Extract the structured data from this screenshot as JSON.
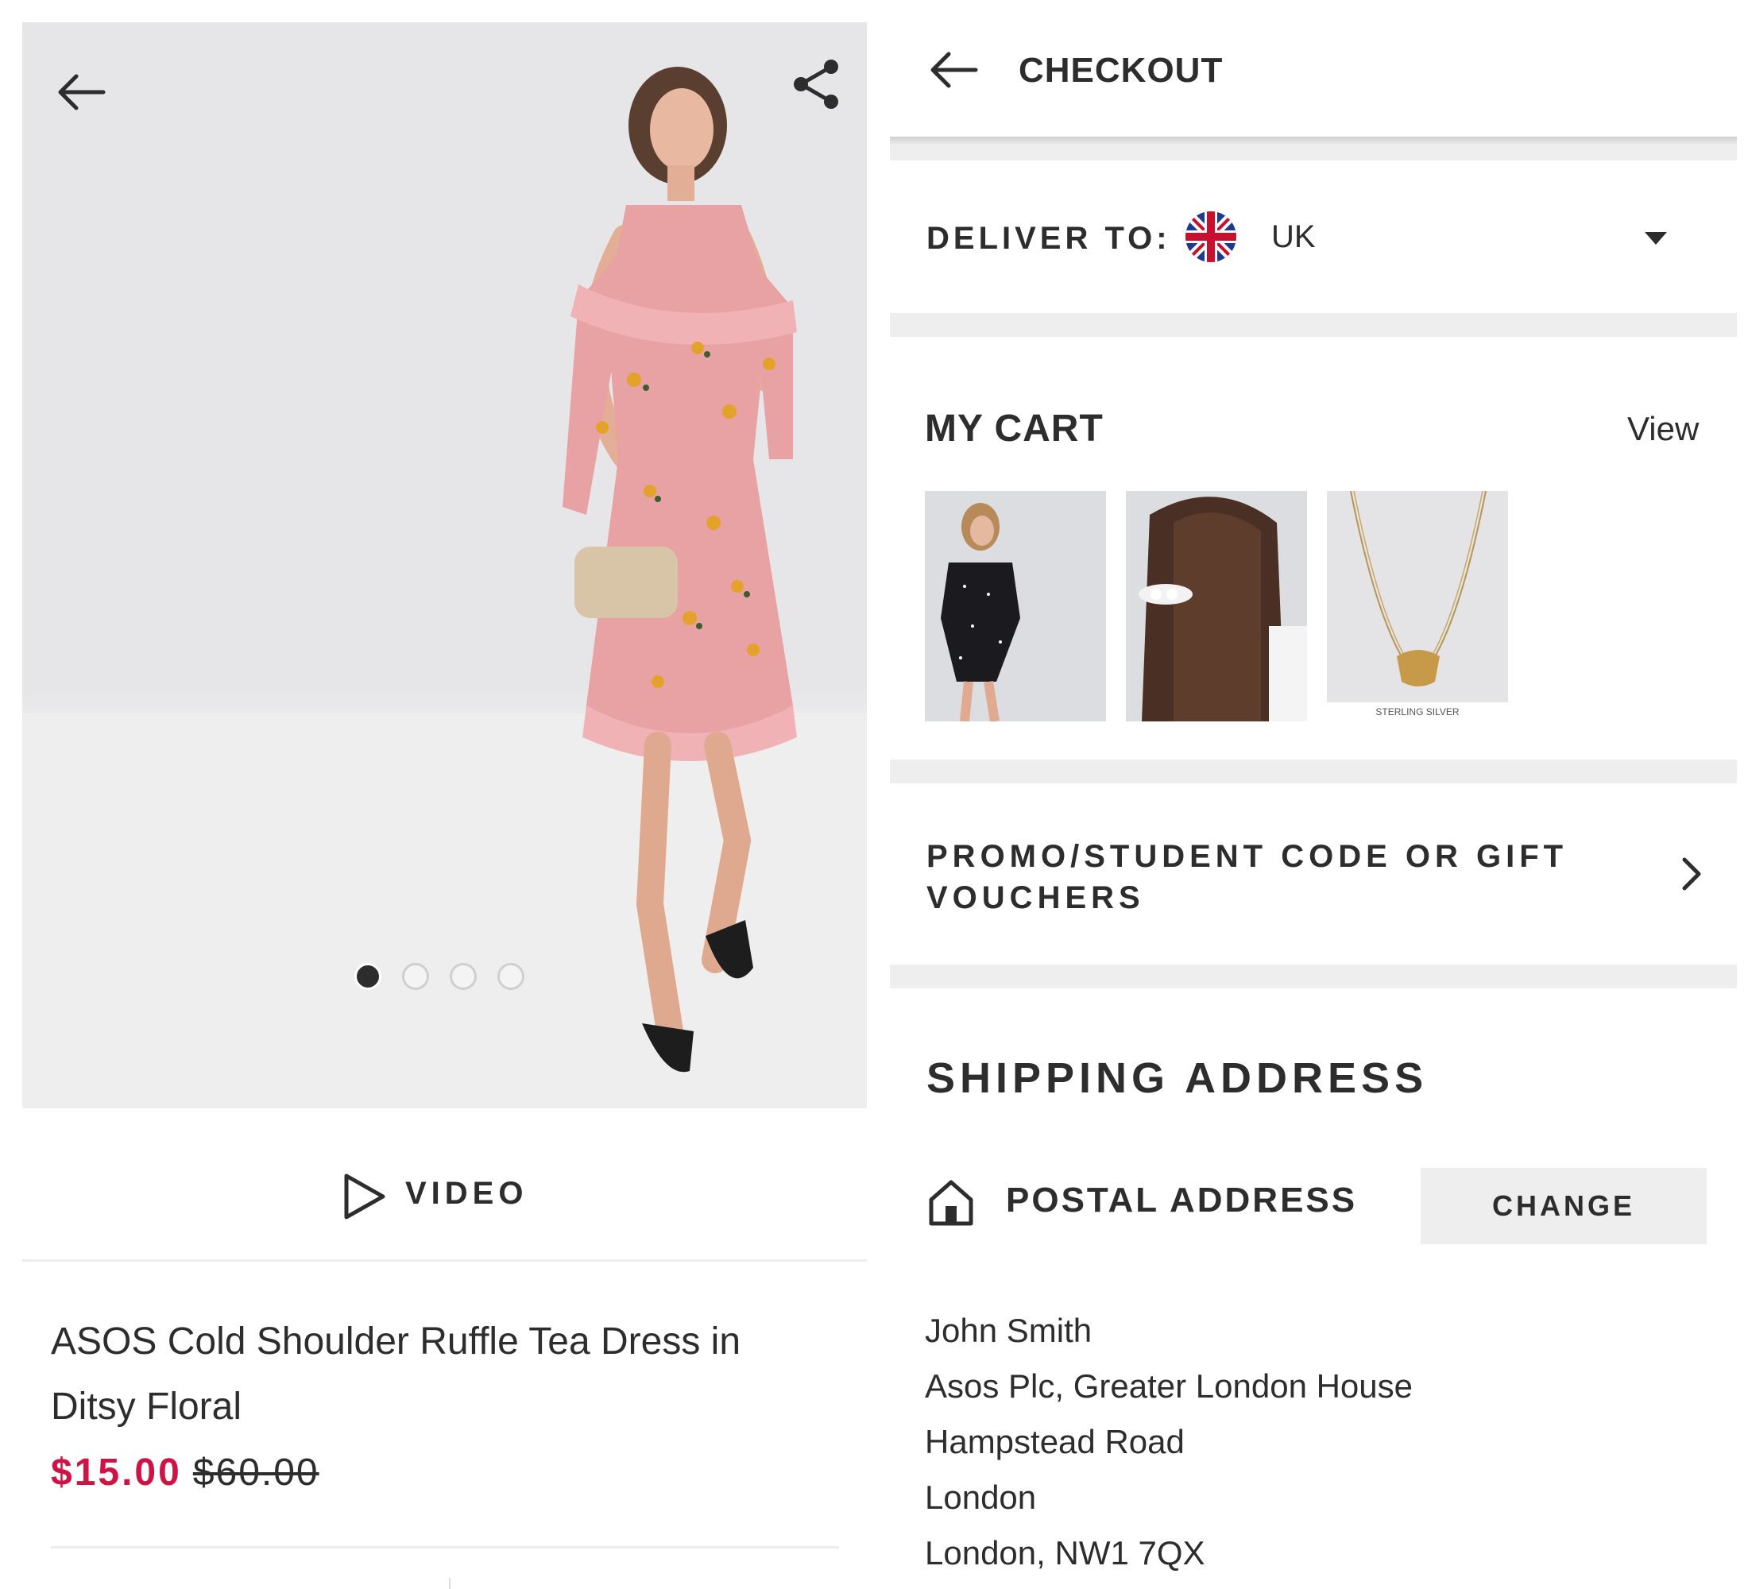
{
  "product_page": {
    "carousel": {
      "slide_count": 4,
      "active_index": 0
    },
    "video_label": "VIDEO",
    "title": "ASOS Cold Shoulder Ruffle Tea Dress in Ditsy Floral",
    "price_now": "$15.00",
    "price_was": "$60.00",
    "colors": {
      "sale_price": "#d01345",
      "text": "#2d2d2d"
    }
  },
  "checkout": {
    "title": "CHECKOUT",
    "deliver_to_label": "DELIVER TO:",
    "country": "UK",
    "country_flag_icon": "uk-flag-icon",
    "cart": {
      "title": "MY CART",
      "view_link": "View",
      "items": [
        {
          "name": "cart-item-dress"
        },
        {
          "name": "cart-item-hair-clip"
        },
        {
          "name": "cart-item-necklace",
          "caption": "STERLING SILVER"
        }
      ]
    },
    "promo_label": "PROMO/STUDENT CODE OR GIFT VOUCHERS",
    "shipping_title": "SHIPPING ADDRESS",
    "postal_label": "POSTAL ADDRESS",
    "change_button": "CHANGE",
    "address_lines": [
      "John Smith",
      "Asos Plc, Greater London House",
      "Hampstead Road",
      "London",
      "London, NW1 7QX"
    ],
    "colors": {
      "section_gap": "#eeeeee",
      "button_bg": "#eeeeee"
    }
  }
}
